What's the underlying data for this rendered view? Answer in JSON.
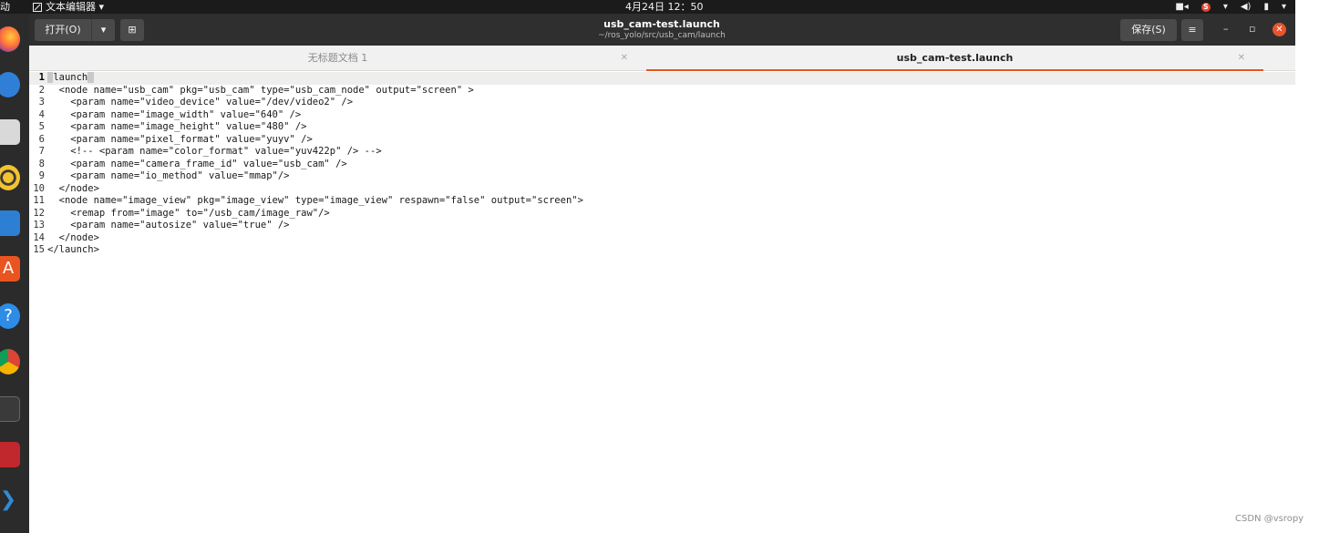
{
  "topbar": {
    "activities": "动",
    "app_menu": "文本编辑器 ▾",
    "clock": "4月24日 12：50"
  },
  "header": {
    "open_label": "打开(O)",
    "save_label": "保存(S)",
    "title": "usb_cam-test.launch",
    "path": "~/ros_yolo/src/usb_cam/launch"
  },
  "tabs": [
    {
      "label": "无标题文档 1",
      "active": false
    },
    {
      "label": "usb_cam-test.launch",
      "active": true
    }
  ],
  "editor": {
    "current_line": 1,
    "lines": [
      {
        "n": "1",
        "text": "launch"
      },
      {
        "n": "2",
        "text": "  <node name=\"usb_cam\" pkg=\"usb_cam\" type=\"usb_cam_node\" output=\"screen\" >"
      },
      {
        "n": "3",
        "text": "    <param name=\"video_device\" value=\"/dev/video2\" />"
      },
      {
        "n": "4",
        "text": "    <param name=\"image_width\" value=\"640\" />"
      },
      {
        "n": "5",
        "text": "    <param name=\"image_height\" value=\"480\" />"
      },
      {
        "n": "6",
        "text": "    <param name=\"pixel_format\" value=\"yuyv\" />"
      },
      {
        "n": "7",
        "text": "    <!-- <param name=\"color_format\" value=\"yuv422p\" /> -->"
      },
      {
        "n": "8",
        "text": "    <param name=\"camera_frame_id\" value=\"usb_cam\" />"
      },
      {
        "n": "9",
        "text": "    <param name=\"io_method\" value=\"mmap\"/>"
      },
      {
        "n": "10",
        "text": "  </node>"
      },
      {
        "n": "11",
        "text": "  <node name=\"image_view\" pkg=\"image_view\" type=\"image_view\" respawn=\"false\" output=\"screen\">"
      },
      {
        "n": "12",
        "text": "    <remap from=\"image\" to=\"/usb_cam/image_raw\"/>"
      },
      {
        "n": "13",
        "text": "    <param name=\"autosize\" value=\"true\" />"
      },
      {
        "n": "14",
        "text": "  </node>"
      },
      {
        "n": "15",
        "text": "</launch>"
      }
    ]
  },
  "watermark": "CSDN @vsropy",
  "colors": {
    "accent": "#e95420",
    "header_bg": "#2f2f2f",
    "topbar_bg": "#1b1b1b",
    "current_line_bg": "#eeeeec"
  }
}
